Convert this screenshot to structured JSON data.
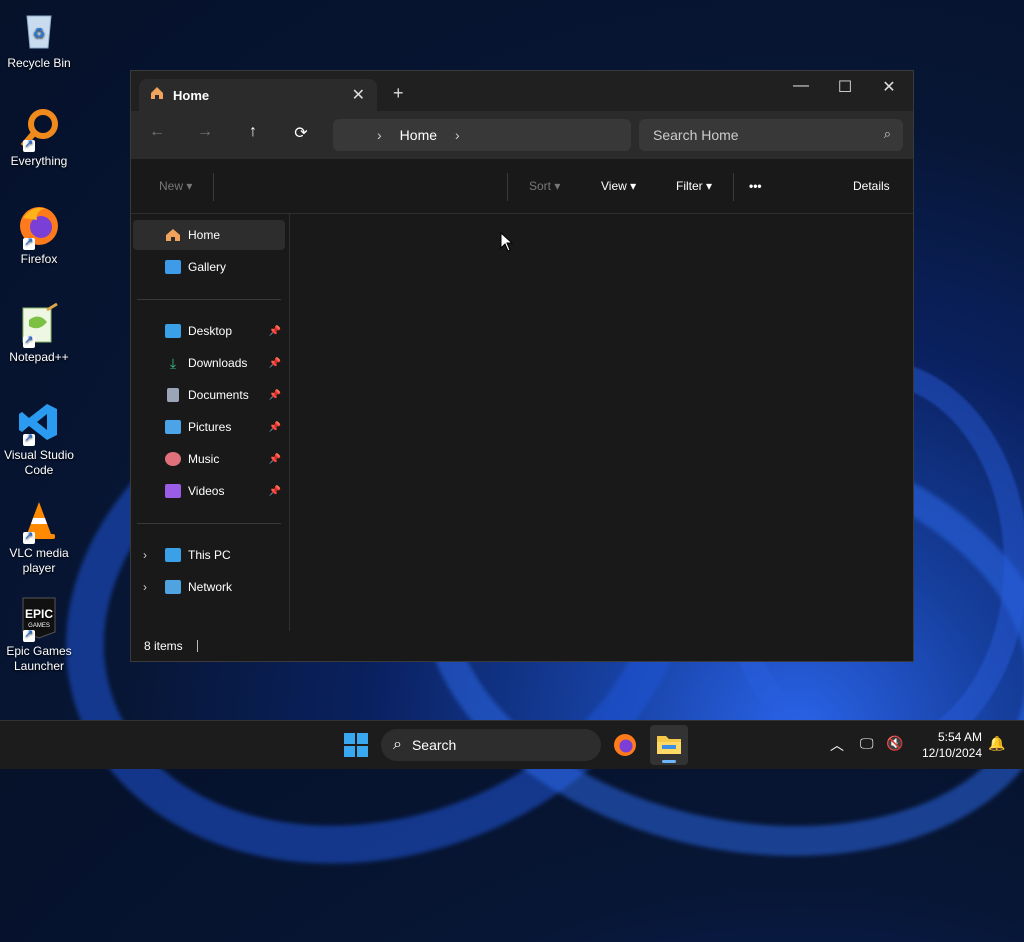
{
  "desktop": {
    "icons": [
      {
        "label": "Recycle Bin"
      },
      {
        "label": "Everything"
      },
      {
        "label": "Firefox"
      },
      {
        "label": "Notepad++"
      },
      {
        "label": "Visual Studio Code"
      },
      {
        "label": "VLC media player"
      },
      {
        "label": "Epic Games Launcher"
      }
    ]
  },
  "explorer": {
    "tab_title": "Home",
    "address_crumb": "Home",
    "search_placeholder": "Search Home",
    "commands": {
      "new": "New",
      "sort": "Sort",
      "view": "View",
      "filter": "Filter",
      "more": "•••",
      "details": "Details"
    },
    "sidebar": {
      "quick": [
        {
          "label": "Home",
          "icon": "home-icon",
          "color": "#f0a35a"
        },
        {
          "label": "Gallery",
          "icon": "gallery-icon",
          "color": "#3d9be9"
        }
      ],
      "pinned": [
        {
          "label": "Desktop",
          "icon": "desktop-folder-icon",
          "color": "#3aa0e8"
        },
        {
          "label": "Downloads",
          "icon": "downloads-icon",
          "color": "#3cc08a"
        },
        {
          "label": "Documents",
          "icon": "documents-icon",
          "color": "#9aa5b8"
        },
        {
          "label": "Pictures",
          "icon": "pictures-icon",
          "color": "#4ba3e8"
        },
        {
          "label": "Music",
          "icon": "music-icon",
          "color": "#e0707a"
        },
        {
          "label": "Videos",
          "icon": "videos-icon",
          "color": "#9b5de5"
        }
      ],
      "devices": [
        {
          "label": "This PC",
          "icon": "this-pc-icon",
          "color": "#3aa0e8"
        },
        {
          "label": "Network",
          "icon": "network-icon",
          "color": "#4fa3e0"
        }
      ]
    },
    "status": "8 items"
  },
  "taskbar": {
    "search_label": "Search",
    "time": "5:54 AM",
    "date": "12/10/2024"
  }
}
